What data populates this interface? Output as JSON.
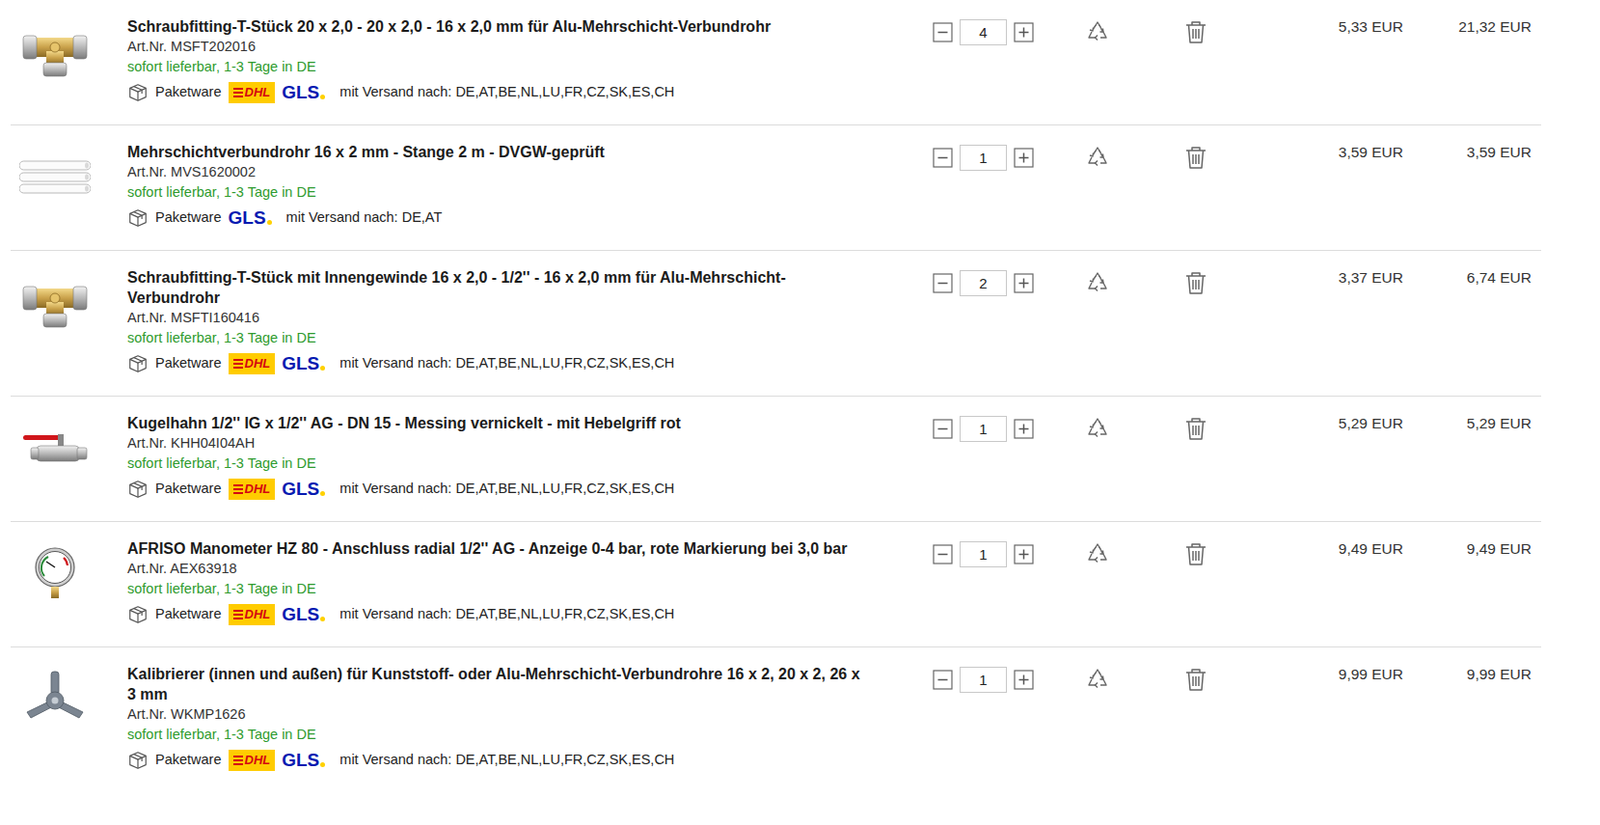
{
  "cart": {
    "items": [
      {
        "kind": "tee",
        "title": "Schraubfitting-T-Stück 20 x 2,0 - 20 x 2,0 - 16 x 2,0 mm für Alu-Mehrschicht-Verbundrohr",
        "article": "Art.Nr. MSFT202016",
        "availability": "sofort lieferbar, 1-3 Tage in DE",
        "package": "Paketware",
        "carriers": [
          {
            "label": "DHL"
          },
          {
            "label": "GLS"
          }
        ],
        "shipping": "mit Versand nach: DE,AT,BE,NL,LU,FR,CZ,SK,ES,CH",
        "quantity": "4",
        "unit_price": "5,33 EUR",
        "total": "21,32 EUR"
      },
      {
        "kind": "pipe",
        "title": "Mehrschichtverbundrohr 16 x 2 mm - Stange 2 m - DVGW-geprüft",
        "article": "Art.Nr. MVS1620002",
        "availability": "sofort lieferbar, 1-3 Tage in DE",
        "package": "Paketware",
        "carriers": [
          {
            "label": "GLS"
          }
        ],
        "shipping": "mit Versand nach: DE,AT",
        "quantity": "1",
        "unit_price": "3,59 EUR",
        "total": "3,59 EUR"
      },
      {
        "kind": "tee",
        "title": "Schraubfitting-T-Stück mit Innengewinde 16 x 2,0 - 1/2'' - 16 x 2,0 mm für Alu-Mehrschicht-Verbundrohr",
        "article": "Art.Nr. MSFTI160416",
        "availability": "sofort lieferbar, 1-3 Tage in DE",
        "package": "Paketware",
        "carriers": [
          {
            "label": "DHL"
          },
          {
            "label": "GLS"
          }
        ],
        "shipping": "mit Versand nach: DE,AT,BE,NL,LU,FR,CZ,SK,ES,CH",
        "quantity": "2",
        "unit_price": "3,37 EUR",
        "total": "6,74 EUR"
      },
      {
        "kind": "valve",
        "title": "Kugelhahn 1/2'' IG x 1/2'' AG - DN 15 - Messing vernickelt - mit Hebelgriff rot",
        "article": "Art.Nr. KHH04I04AH",
        "availability": "sofort lieferbar, 1-3 Tage in DE",
        "package": "Paketware",
        "carriers": [
          {
            "label": "DHL"
          },
          {
            "label": "GLS"
          }
        ],
        "shipping": "mit Versand nach: DE,AT,BE,NL,LU,FR,CZ,SK,ES,CH",
        "quantity": "1",
        "unit_price": "5,29 EUR",
        "total": "5,29 EUR"
      },
      {
        "kind": "gauge",
        "title": "AFRISO Manometer HZ 80 - Anschluss radial 1/2'' AG - Anzeige 0-4 bar, rote Markierung bei 3,0 bar",
        "article": "Art.Nr. AEX63918",
        "availability": "sofort lieferbar, 1-3 Tage in DE",
        "package": "Paketware",
        "carriers": [
          {
            "label": "DHL"
          },
          {
            "label": "GLS"
          }
        ],
        "shipping": "mit Versand nach: DE,AT,BE,NL,LU,FR,CZ,SK,ES,CH",
        "quantity": "1",
        "unit_price": "9,49 EUR",
        "total": "9,49 EUR"
      },
      {
        "kind": "calibrator",
        "title": "Kalibrierer (innen und außen) für Kunststoff- oder Alu-Mehrschicht-Verbundrohre 16 x 2, 20 x 2, 26 x 3 mm",
        "article": "Art.Nr. WKMP1626",
        "availability": "sofort lieferbar, 1-3 Tage in DE",
        "package": "Paketware",
        "carriers": [
          {
            "label": "DHL"
          },
          {
            "label": "GLS"
          }
        ],
        "shipping": "mit Versand nach: DE,AT,BE,NL,LU,FR,CZ,SK,ES,CH",
        "quantity": "1",
        "unit_price": "9,99 EUR",
        "total": "9,99 EUR"
      }
    ]
  }
}
